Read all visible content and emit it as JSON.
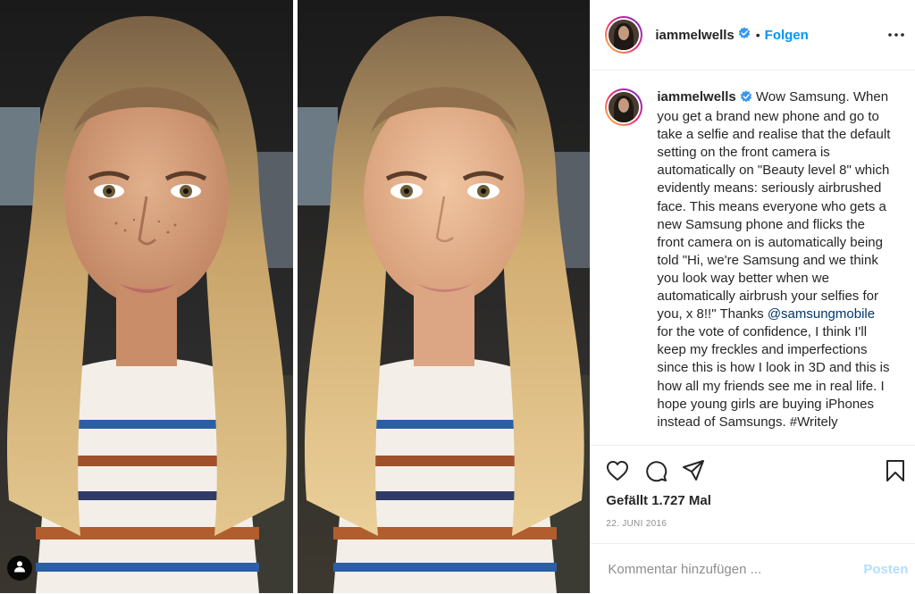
{
  "post": {
    "username": "iammelwells",
    "follow_label": "Folgen",
    "separator": "•",
    "caption": {
      "text_before_mention": "Wow Samsung. When you get a brand new phone and go to take a selfie and realise that the default setting on the front camera is automatically on \"Beauty level 8\" which evidently means: seriously airbrushed face. This means everyone who gets a new Samsung phone and flicks the front camera on is automatically being told \"Hi, we're Samsung and we think you look way better when we automatically airbrush your selfies for you, x 8!!\" Thanks ",
      "mention": "@samsungmobile",
      "text_after_mention": " for the vote of confidence, I think I'll keep my freckles and imperfections since this is how I look in 3D and this is how all my friends see me in real life. I hope young girls are buying iPhones instead of Samsungs. #Writely"
    },
    "likes_text": "Gefällt 1.727 Mal",
    "date": "22. JUNI 2016",
    "comment_placeholder": "Kommentar hinzufügen ...",
    "post_button": "Posten"
  },
  "icons": {
    "header": [
      "verified-badge-icon",
      "more-options-icon"
    ],
    "actions": [
      "heart-icon",
      "comment-icon",
      "share-icon",
      "bookmark-icon"
    ],
    "media": [
      "user-tag-icon"
    ]
  },
  "colors": {
    "link_blue": "#0095f6",
    "mention_blue": "#00376b",
    "post_disabled": "#b2dffc",
    "muted_text": "#8e8e8e",
    "border": "#efefef"
  }
}
